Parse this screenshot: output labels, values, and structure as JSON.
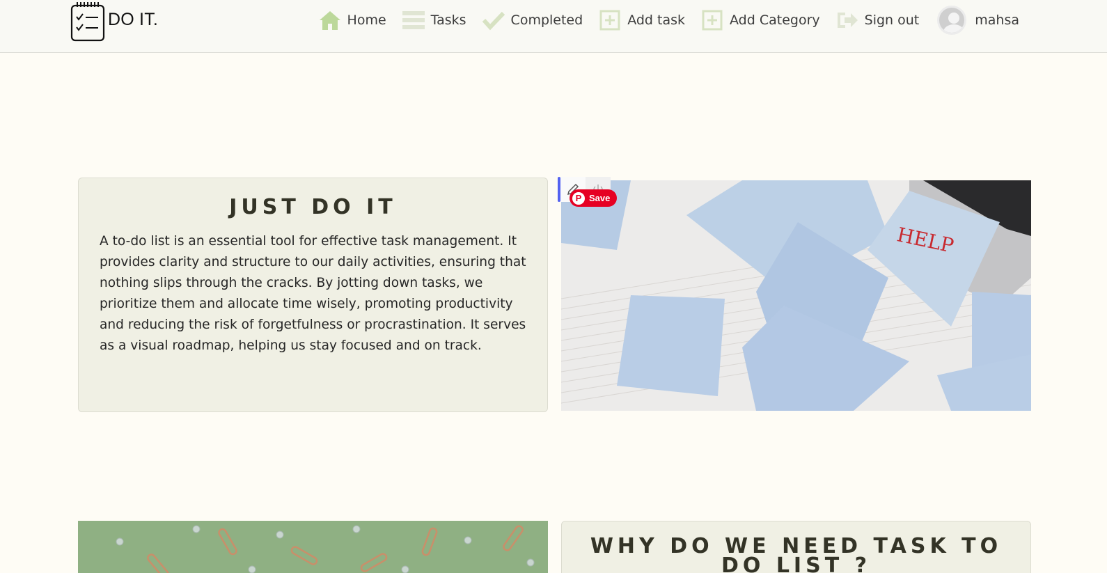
{
  "brand": {
    "name": "DO IT."
  },
  "nav": {
    "items": [
      {
        "label": "Home",
        "icon": "home-icon"
      },
      {
        "label": "Tasks",
        "icon": "list-icon"
      },
      {
        "label": "Completed",
        "icon": "check-icon"
      },
      {
        "label": "Add task",
        "icon": "plus-square-icon"
      },
      {
        "label": "Add Category",
        "icon": "plus-square-icon"
      },
      {
        "label": "Sign out",
        "icon": "sign-out-icon"
      }
    ],
    "user": {
      "name": "mahsa",
      "icon": "avatar-icon"
    }
  },
  "intro": {
    "title": "JUST DO IT",
    "text": "A to-do list is an essential tool for effective task management. It provides clarity and structure to our daily activities, ensuring that nothing slips through the cracks. By jotting down tasks, we prioritize them and allocate time wisely, promoting productivity and reducing the risk of forgetfulness or procrastination. It serves as a visual roadmap, helping us stay focused and on track."
  },
  "photo1": {
    "note_text": "HELP",
    "save_label": "Save"
  },
  "why": {
    "title": "WHY DO WE NEED TASK TO DO LIST ?"
  },
  "colors": {
    "accent": "#bcd89a",
    "background": "#fefcf5",
    "card": "#f0f0e4",
    "pinterest": "#e60023"
  }
}
